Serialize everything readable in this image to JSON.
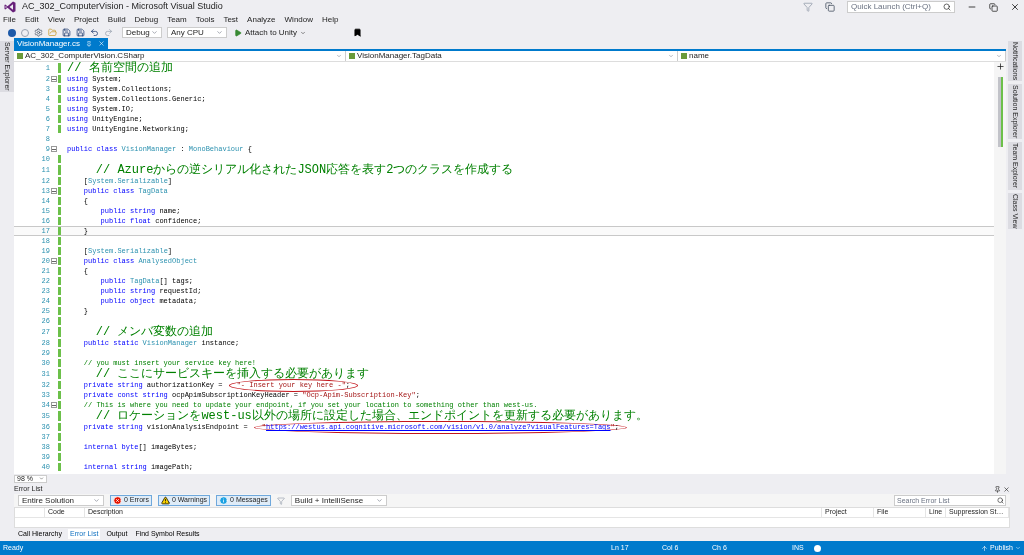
{
  "window": {
    "title": "AC_302_ComputerVision - Microsoft Visual Studio",
    "quick_launch": {
      "placeholder": "Quick Launch (Ctrl+Q)"
    }
  },
  "menu": [
    "File",
    "Edit",
    "View",
    "Project",
    "Build",
    "Debug",
    "Team",
    "Tools",
    "Test",
    "Analyze",
    "Window",
    "Help"
  ],
  "toolbar": {
    "configuration": "Debug",
    "platform": "Any CPU",
    "run": "Attach to Unity"
  },
  "left_strip": [
    "Server Explorer"
  ],
  "right_strip": [
    "Notifications",
    "Solution Explorer",
    "Team Explorer",
    "Class View"
  ],
  "tabs": [
    {
      "label": "VisionManager.cs",
      "selected": true
    }
  ],
  "navigation": [
    "AC_302_ComputerVision.CSharp",
    "VisionManager.TagData",
    "name"
  ],
  "editor": {
    "zoom": "98 %",
    "lines": [
      {
        "n": "1",
        "changed": true,
        "fold": false,
        "current": false,
        "tokens": [
          {
            "kind": "comment_ja",
            "text": "// 名前空間の追加"
          }
        ]
      },
      {
        "n": "2",
        "changed": true,
        "fold": true,
        "current": false,
        "tokens": [
          {
            "kind": "keyword",
            "text": "using"
          },
          {
            "kind": "plain",
            "text": " System;"
          }
        ]
      },
      {
        "n": "3",
        "changed": true,
        "fold": false,
        "current": false,
        "tokens": [
          {
            "kind": "keyword",
            "text": "using"
          },
          {
            "kind": "plain",
            "text": " System.Collections;"
          }
        ]
      },
      {
        "n": "4",
        "changed": true,
        "fold": false,
        "current": false,
        "tokens": [
          {
            "kind": "keyword",
            "text": "using"
          },
          {
            "kind": "plain",
            "text": " System.Collections.Generic;"
          }
        ]
      },
      {
        "n": "5",
        "changed": true,
        "fold": false,
        "current": false,
        "tokens": [
          {
            "kind": "keyword",
            "text": "using"
          },
          {
            "kind": "plain",
            "text": " System.IO;"
          }
        ]
      },
      {
        "n": "6",
        "changed": true,
        "fold": false,
        "current": false,
        "tokens": [
          {
            "kind": "keyword",
            "text": "using"
          },
          {
            "kind": "plain",
            "text": " UnityEngine;"
          }
        ]
      },
      {
        "n": "7",
        "changed": true,
        "fold": false,
        "current": false,
        "tokens": [
          {
            "kind": "keyword",
            "text": "using"
          },
          {
            "kind": "plain",
            "text": " UnityEngine.Networking;"
          }
        ]
      },
      {
        "n": "8",
        "changed": false,
        "fold": false,
        "current": false
      },
      {
        "n": "9",
        "changed": false,
        "fold": true,
        "current": false,
        "tokens": [
          {
            "kind": "keyword",
            "text": "public class"
          },
          {
            "kind": "type",
            "text": " VisionManager"
          },
          {
            "kind": "plain",
            "text": " : "
          },
          {
            "kind": "type",
            "text": "MonoBehaviour"
          },
          {
            "kind": "plain",
            "text": " {"
          }
        ]
      },
      {
        "n": "10",
        "changed": true,
        "fold": false,
        "current": false
      },
      {
        "n": "11",
        "changed": true,
        "fold": false,
        "current": false,
        "tokens": [
          {
            "kind": "comment_ja",
            "text": "    // Azureからの逆シリアル化されたJSON応答を表す2つのクラスを作成する"
          }
        ]
      },
      {
        "n": "12",
        "changed": true,
        "fold": false,
        "current": false,
        "tokens": [
          {
            "kind": "plain",
            "text": "    ["
          },
          {
            "kind": "type",
            "text": "System.Serializable"
          },
          {
            "kind": "plain",
            "text": "]"
          }
        ]
      },
      {
        "n": "13",
        "changed": true,
        "fold": true,
        "current": false,
        "tokens": [
          {
            "kind": "keyword",
            "text": "    public class"
          },
          {
            "kind": "type",
            "text": " TagData"
          }
        ]
      },
      {
        "n": "14",
        "changed": true,
        "fold": false,
        "current": false,
        "tokens": [
          {
            "kind": "plain",
            "text": "    {"
          }
        ]
      },
      {
        "n": "15",
        "changed": true,
        "fold": false,
        "current": false,
        "tokens": [
          {
            "kind": "keyword",
            "text": "        public string"
          },
          {
            "kind": "plain",
            "text": " name;"
          }
        ]
      },
      {
        "n": "16",
        "changed": true,
        "fold": false,
        "current": false,
        "tokens": [
          {
            "kind": "keyword",
            "text": "        public float"
          },
          {
            "kind": "plain",
            "text": " confidence;"
          }
        ]
      },
      {
        "n": "17",
        "changed": true,
        "fold": false,
        "current": true,
        "tokens": [
          {
            "kind": "plain",
            "text": "    }"
          }
        ]
      },
      {
        "n": "18",
        "changed": true,
        "fold": false,
        "current": false
      },
      {
        "n": "19",
        "changed": true,
        "fold": false,
        "current": false,
        "tokens": [
          {
            "kind": "plain",
            "text": "    ["
          },
          {
            "kind": "type",
            "text": "System.Serializable"
          },
          {
            "kind": "plain",
            "text": "]"
          }
        ]
      },
      {
        "n": "20",
        "changed": true,
        "fold": true,
        "current": false,
        "tokens": [
          {
            "kind": "keyword",
            "text": "    public class"
          },
          {
            "kind": "type",
            "text": " AnalysedObject"
          }
        ]
      },
      {
        "n": "21",
        "changed": true,
        "fold": false,
        "current": false,
        "tokens": [
          {
            "kind": "plain",
            "text": "    {"
          }
        ]
      },
      {
        "n": "22",
        "changed": true,
        "fold": false,
        "current": false,
        "tokens": [
          {
            "kind": "keyword",
            "text": "        public"
          },
          {
            "kind": "type",
            "text": " TagData"
          },
          {
            "kind": "plain",
            "text": "[] tags;"
          }
        ]
      },
      {
        "n": "23",
        "changed": true,
        "fold": false,
        "current": false,
        "tokens": [
          {
            "kind": "keyword",
            "text": "        public string"
          },
          {
            "kind": "plain",
            "text": " requestId;"
          }
        ]
      },
      {
        "n": "24",
        "changed": true,
        "fold": false,
        "current": false,
        "tokens": [
          {
            "kind": "keyword",
            "text": "        public object"
          },
          {
            "kind": "plain",
            "text": " metadata;"
          }
        ]
      },
      {
        "n": "25",
        "changed": true,
        "fold": false,
        "current": false,
        "tokens": [
          {
            "kind": "plain",
            "text": "    }"
          }
        ]
      },
      {
        "n": "26",
        "changed": true,
        "fold": false,
        "current": false
      },
      {
        "n": "27",
        "changed": true,
        "fold": false,
        "current": false,
        "tokens": [
          {
            "kind": "comment_ja",
            "text": "    // メンバ変数の追加"
          }
        ]
      },
      {
        "n": "28",
        "changed": true,
        "fold": false,
        "current": false,
        "tokens": [
          {
            "kind": "keyword",
            "text": "    public static"
          },
          {
            "kind": "type",
            "text": " VisionManager"
          },
          {
            "kind": "plain",
            "text": " instance;"
          }
        ]
      },
      {
        "n": "29",
        "changed": true,
        "fold": false,
        "current": false
      },
      {
        "n": "30",
        "changed": true,
        "fold": false,
        "current": false,
        "tokens": [
          {
            "kind": "comment",
            "text": "    // you must insert your service key here!"
          }
        ]
      },
      {
        "n": "31",
        "changed": true,
        "fold": false,
        "current": false,
        "tokens": [
          {
            "kind": "comment_ja",
            "text": "    // ここにサービスキーを挿入する必要があります"
          }
        ]
      },
      {
        "n": "32",
        "changed": true,
        "fold": false,
        "current": false,
        "tokens": [
          {
            "kind": "keyword",
            "text": "    private string"
          },
          {
            "kind": "plain",
            "text": " authorizationKey = "
          }
        ],
        "circled": [
          {
            "kind": "string",
            "text": "\"- Insert your key here -\""
          },
          {
            "kind": "plain",
            "text": ";"
          }
        ]
      },
      {
        "n": "33",
        "changed": true,
        "fold": false,
        "current": false,
        "tokens": [
          {
            "kind": "keyword",
            "text": "    private const string"
          },
          {
            "kind": "plain",
            "text": " ocpApimSubscriptionKeyHeader = "
          },
          {
            "kind": "string",
            "text": "\"Ocp-Apim-Subscription-Key\""
          },
          {
            "kind": "plain",
            "text": ";"
          }
        ]
      },
      {
        "n": "34",
        "changed": true,
        "fold": true,
        "current": false,
        "tokens": [
          {
            "kind": "comment",
            "text": "    // This is where you need to update your endpoint, if you set your location to something other than west-us."
          }
        ]
      },
      {
        "n": "35",
        "changed": true,
        "fold": false,
        "current": false,
        "tokens": [
          {
            "kind": "comment_ja",
            "text": "    // ロケーションをwest-us以外の場所に設定した場合、エンドポイントを更新する必要があります。"
          }
        ]
      },
      {
        "n": "36",
        "changed": true,
        "fold": false,
        "current": false,
        "tokens": [
          {
            "kind": "keyword",
            "text": "    private string"
          },
          {
            "kind": "plain",
            "text": " visionAnalysisEndpoint = "
          }
        ],
        "circled": [
          {
            "kind": "string",
            "text": "\""
          },
          {
            "kind": "url",
            "text": "https://westus.api.cognitive.microsoft.com/vision/v1.0/analyze?visualFeatures=Tags"
          },
          {
            "kind": "string",
            "text": "\""
          },
          {
            "kind": "plain",
            "text": ";"
          }
        ]
      },
      {
        "n": "37",
        "changed": true,
        "fold": false,
        "current": false
      },
      {
        "n": "38",
        "changed": true,
        "fold": false,
        "current": false,
        "tokens": [
          {
            "kind": "keyword",
            "text": "    internal byte"
          },
          {
            "kind": "plain",
            "text": "[] imageBytes;"
          }
        ]
      },
      {
        "n": "39",
        "changed": true,
        "fold": false,
        "current": false
      },
      {
        "n": "40",
        "changed": true,
        "fold": false,
        "current": false,
        "tokens": [
          {
            "kind": "keyword",
            "text": "    internal string"
          },
          {
            "kind": "plain",
            "text": " imagePath;"
          }
        ]
      }
    ]
  },
  "error_list": {
    "title": "Error List",
    "scope": "Entire Solution",
    "filters": [
      {
        "kind": "error",
        "label": "0 Errors",
        "selected": true
      },
      {
        "kind": "warning",
        "label": "0 Warnings",
        "selected": true
      },
      {
        "kind": "message",
        "label": "0 Messages",
        "selected": true
      }
    ],
    "source": "Build + IntelliSense",
    "search": {
      "placeholder": "Search Error List"
    },
    "columns": [
      "Code",
      "Description",
      "Project",
      "File",
      "Line",
      "Suppression St…"
    ]
  },
  "bottom_tabs": [
    {
      "label": "Call Hierarchy",
      "selected": false
    },
    {
      "label": "Error List",
      "selected": true
    },
    {
      "label": "Output",
      "selected": false
    },
    {
      "label": "Find Symbol Results",
      "selected": false
    }
  ],
  "status_bar": {
    "state": "Ready",
    "line": "Ln 17",
    "column": "Col 6",
    "char": "Ch 6",
    "mode": "INS",
    "publish": "Publish"
  }
}
